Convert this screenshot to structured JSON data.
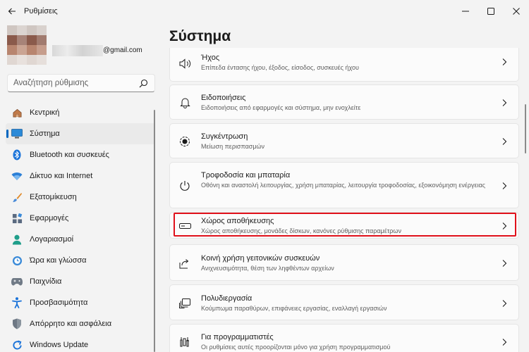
{
  "window": {
    "title": "Ρυθμίσεις"
  },
  "profile": {
    "email": "@gmail.com"
  },
  "search": {
    "placeholder": "Αναζήτηση ρύθμισης"
  },
  "page": {
    "title": "Σύστημα"
  },
  "nav": {
    "items": [
      {
        "label": "Κεντρική",
        "icon": "home-icon"
      },
      {
        "label": "Σύστημα",
        "icon": "system-icon",
        "active": true
      },
      {
        "label": "Bluetooth και συσκευές",
        "icon": "bluetooth-icon"
      },
      {
        "label": "Δίκτυο και Internet",
        "icon": "wifi-icon"
      },
      {
        "label": "Εξατομίκευση",
        "icon": "brush-icon"
      },
      {
        "label": "Εφαρμογές",
        "icon": "apps-icon"
      },
      {
        "label": "Λογαριασμοί",
        "icon": "account-icon"
      },
      {
        "label": "Ώρα και γλώσσα",
        "icon": "time-language-icon"
      },
      {
        "label": "Παιχνίδια",
        "icon": "gamepad-icon"
      },
      {
        "label": "Προσβασιμότητα",
        "icon": "accessibility-icon"
      },
      {
        "label": "Απόρρητο και ασφάλεια",
        "icon": "shield-icon"
      },
      {
        "label": "Windows Update",
        "icon": "update-icon"
      }
    ]
  },
  "settings": [
    {
      "title": "Ήχος",
      "desc": "Επίπεδα έντασης ήχου, έξοδος, είσοδος, συσκευές ήχου",
      "icon": "speaker-icon"
    },
    {
      "title": "Ειδοποιήσεις",
      "desc": "Ειδοποιήσεις από εφαρμογές και σύστημα, μην ενοχλείτε",
      "icon": "bell-icon"
    },
    {
      "title": "Συγκέντρωση",
      "desc": "Μείωση περισπασμών",
      "icon": "focus-icon"
    },
    {
      "title": "Τροφοδοσία και μπαταρία",
      "desc": "Οθόνη και αναστολή λειτουργίας, χρήση μπαταρίας, λειτουργία τροφοδοσίας, εξοικονόμηση ενέργειας",
      "icon": "power-icon"
    },
    {
      "title": "Χώρος αποθήκευσης",
      "desc": "Χώρος αποθήκευσης, μονάδες δίσκων, κανόνες ρύθμισης παραμέτρων",
      "icon": "storage-icon"
    },
    {
      "title": "Κοινή χρήση γειτονικών συσκευών",
      "desc": "Ανιχνευσιμότητα, θέση των ληφθέντων αρχείων",
      "icon": "share-icon"
    },
    {
      "title": "Πολυδιεργασία",
      "desc": "Κούμπωμα παραθύρων, επιφάνειες εργασίας, εναλλαγή εργασιών",
      "icon": "multitask-icon"
    },
    {
      "title": "Για προγραμματιστές",
      "desc": "Οι ρυθμίσεις αυτές προορίζονται μόνο για χρήση προγραμματισμού",
      "icon": "developer-icon"
    }
  ],
  "colors": {
    "accent": "#0067c0",
    "highlight": "#e0101a"
  }
}
